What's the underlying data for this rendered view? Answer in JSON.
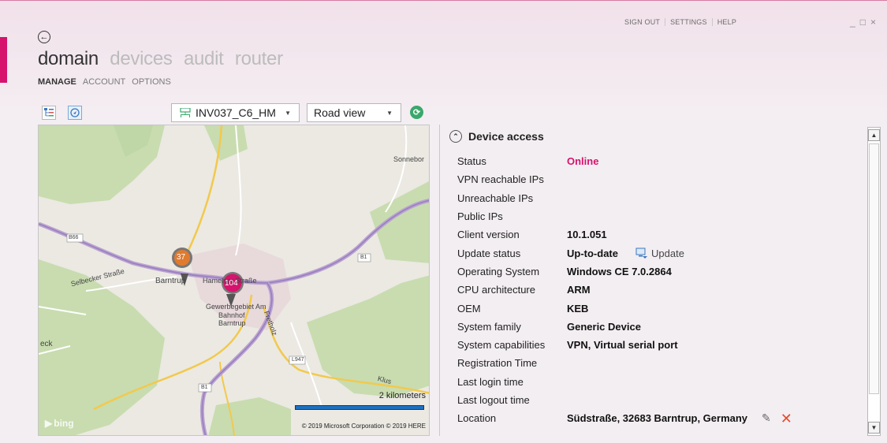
{
  "topnav": {
    "sign_out": "SIGN OUT",
    "settings": "SETTINGS",
    "help": "HELP"
  },
  "window_controls": {
    "minimize": "_",
    "maximize": "□",
    "close": "×"
  },
  "main_nav": [
    "domain",
    "devices",
    "audit",
    "router"
  ],
  "main_nav_active": "domain",
  "sub_nav": [
    "MANAGE",
    "ACCOUNT",
    "OPTIONS"
  ],
  "sub_nav_active": "MANAGE",
  "toolbar": {
    "device_selector": "INV037_C6_HM",
    "view_selector": "Road view"
  },
  "map": {
    "labels": {
      "sonnebo": "Sonnebor",
      "b66": "B66",
      "b1_east": "B1",
      "b1_south": "B1",
      "selbecker": "Selbecker Straße",
      "barntrup": "Barntrup",
      "hamelner": "Hamelner Straße",
      "gewerbe1": "Gewerbegebiet Am",
      "gewerbe2": "Bahnhof",
      "gewerbe3": "Barntrup",
      "eck": "eck",
      "l947": "L947",
      "klus": "Klus",
      "fretholz": "Fretholz"
    },
    "markers": {
      "orange": "37",
      "pink": "104"
    },
    "scale_label": "2 kilometers",
    "copyright": "© 2019 Microsoft Corporation   © 2019 HERE",
    "logo": "bing"
  },
  "panel": {
    "title": "Device access",
    "rows": [
      {
        "label": "Status",
        "value": "Online"
      },
      {
        "label": "VPN reachable IPs",
        "value": ""
      },
      {
        "label": "Unreachable IPs",
        "value": ""
      },
      {
        "label": "Public IPs",
        "value": ""
      },
      {
        "label": "Client version",
        "value": "10.1.051"
      },
      {
        "label": "Update status",
        "value": "Up-to-date"
      },
      {
        "label": "Operating System",
        "value": "Windows CE 7.0.2864"
      },
      {
        "label": "CPU architecture",
        "value": "ARM"
      },
      {
        "label": "OEM",
        "value": "KEB"
      },
      {
        "label": "System family",
        "value": "Generic Device"
      },
      {
        "label": "System capabilities",
        "value": "VPN, Virtual serial port"
      },
      {
        "label": "Registration Time",
        "value": ""
      },
      {
        "label": "Last login time",
        "value": ""
      },
      {
        "label": "Last logout time",
        "value": ""
      },
      {
        "label": "Location",
        "value": "Südstraße, 32683 Barntrup, Germany"
      }
    ],
    "update_link": "Update"
  },
  "colors": {
    "accent": "#d6136d",
    "online": "#d6136d",
    "delete": "#e74a2a"
  }
}
